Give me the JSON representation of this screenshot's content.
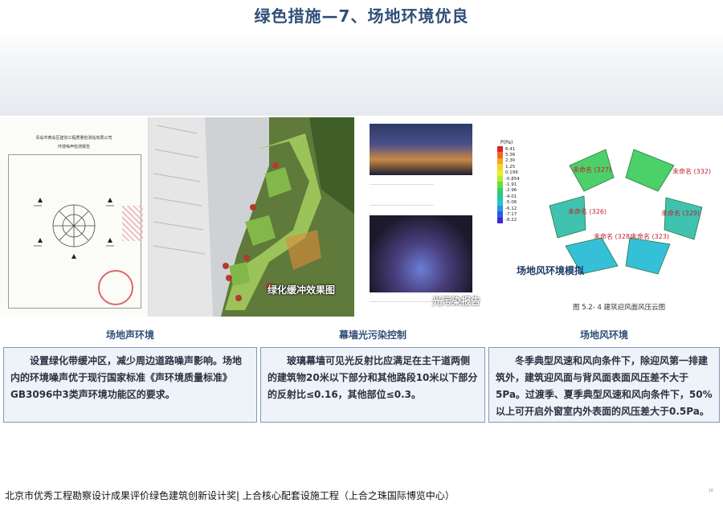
{
  "title": "绿色措施—7、场地环境优良",
  "colors": {
    "title": "#2f4f78",
    "box_border": "#7f9ab8",
    "box_bg": "#eef3f9"
  },
  "images": {
    "report": {
      "org": "青岛市黄岛区建协工程质量检测站有限公司",
      "doc": "环境噪声检测报告"
    },
    "landscape": {
      "overlay": "绿化缓冲效果图",
      "markers": [
        "1",
        "2",
        "3",
        "4",
        "5",
        "6",
        "7"
      ]
    },
    "light": {
      "overlay": "光污染报告"
    },
    "wind": {
      "legend_title": "P(Pa)",
      "legend_values": [
        "6.41",
        "5.36",
        "2.30",
        "1.25",
        "0.199",
        "-0.854",
        "-1.91",
        "-2.96",
        "-4.01",
        "-5.06",
        "-6.12",
        "-7.17",
        "-8.22"
      ],
      "legend_colors": [
        "#e0202a",
        "#ec6b21",
        "#f4a624",
        "#f5d623",
        "#e8ee2a",
        "#b7ea31",
        "#6bdc3a",
        "#35cf63",
        "#25c79b",
        "#23c3d2",
        "#2496e6",
        "#2b5de4",
        "#3a2bd6"
      ],
      "labels": [
        "未命名 (327)",
        "未命名 (332)",
        "未命名 (326)",
        "未命名 (329)",
        "未命名 (323)",
        "未命名 (328)"
      ],
      "overlay": "场地风环境模拟",
      "figure_caption": "图 5.2- 4  建筑迎风面风压云图"
    }
  },
  "sections": [
    {
      "caption": "场地声环境",
      "body": "设置绿化带缓冲区，减少周边道路噪声影响。场地内的环境噪声优于现行国家标准《声环境质量标准》GB3096中3类声环境功能区的要求。"
    },
    {
      "caption": "幕墙光污染控制",
      "body": "玻璃幕墙可见光反射比应满足在主干道两侧的建筑物20米以下部分和其他路段10米以下部分的反射比≤0.16，其他部位≤0.3。"
    },
    {
      "caption": "场地风环境",
      "body": "冬季典型风速和风向条件下，除迎风第一排建筑外，建筑迎风面与背风面表面风压差不大于5Pa。过渡季、夏季典型风速和风向条件下，50%以上可开启外窗室内外表面的风压差大于0.5Pa。"
    }
  ],
  "footer": "北京市优秀工程勘察设计成果评价绿色建筑创新设计奖| 上合核心配套设施工程（上合之珠国际博览中心）",
  "page_number": "16"
}
